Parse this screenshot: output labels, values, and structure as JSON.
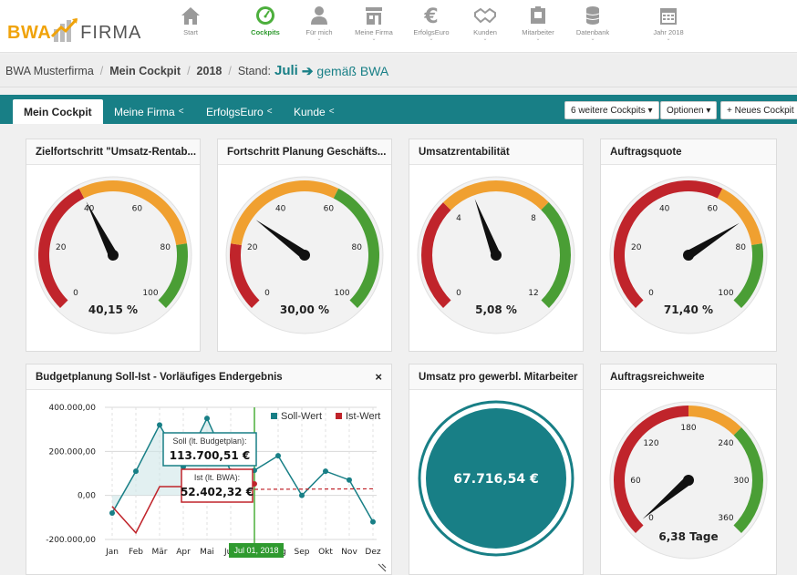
{
  "header": {
    "logo_left": "BWA",
    "logo_right": "FIRMA",
    "nav": [
      {
        "label": "Start",
        "icon": "home-icon"
      },
      {
        "label": "Cockpits",
        "icon": "gauge-icon",
        "active": true
      },
      {
        "label": "Für mich",
        "icon": "person-icon"
      },
      {
        "label": "Meine Firma",
        "icon": "building-icon"
      },
      {
        "label": "ErfolgsEuro",
        "icon": "euro-icon"
      },
      {
        "label": "Kunden",
        "icon": "handshake-icon"
      },
      {
        "label": "Mitarbeiter",
        "icon": "id-badge-icon"
      },
      {
        "label": "Datenbank",
        "icon": "database-icon"
      },
      {
        "label": "Jahr 2018",
        "icon": "calendar-icon"
      }
    ]
  },
  "breadcrumb": {
    "company": "BWA Musterfirma",
    "cockpit": "Mein Cockpit",
    "year": "2018",
    "stand_label": "Stand:",
    "month": "Juli",
    "source": "gemäß BWA"
  },
  "tabs": {
    "items": [
      "Mein Cockpit",
      "Meine Firma",
      "ErfolgsEuro",
      "Kunde"
    ],
    "more_cockpits": "6 weitere Cockpits ▾",
    "options": "Optionen ▾",
    "new_cockpit": "+ Neues Cockpit"
  },
  "gauges": [
    {
      "title": "Zielfortschritt \"Umsatz-Rentab...",
      "ticks": [
        "0",
        "20",
        "40",
        "60",
        "80",
        "100"
      ],
      "value_text": "40,15 %",
      "fraction": 0.4015,
      "bands": [
        "#c0242b",
        "#f0a030",
        "#4a9e35"
      ],
      "band_split": [
        0.4,
        0.8
      ]
    },
    {
      "title": "Fortschritt Planung Geschäfts...",
      "ticks": [
        "0",
        "20",
        "40",
        "60",
        "80",
        "100"
      ],
      "value_text": "30,00 %",
      "fraction": 0.3,
      "bands": [
        "#c0242b",
        "#f0a030",
        "#4a9e35"
      ],
      "band_split": [
        0.2,
        0.6
      ]
    },
    {
      "title": "Umsatzrentabilität",
      "ticks": [
        "0",
        "4",
        "8",
        "12"
      ],
      "value_text": "5,08 %",
      "fraction": 0.4233,
      "bands": [
        "#c0242b",
        "#f0a030",
        "#4a9e35"
      ],
      "band_split": [
        0.333,
        0.666
      ]
    },
    {
      "title": "Auftragsquote",
      "ticks": [
        "0",
        "20",
        "40",
        "60",
        "80",
        "100"
      ],
      "value_text": "71,40 %",
      "fraction": 0.714,
      "bands": [
        "#c0242b",
        "#f0a030",
        "#4a9e35"
      ],
      "band_split": [
        0.6,
        0.8
      ]
    }
  ],
  "budget": {
    "title": "Budgetplanung Soll-Ist - Vorläufiges Endergebnis",
    "close": "×",
    "legend_soll": "Soll-Wert",
    "legend_ist": "Ist-Wert",
    "tooltip_soll_label": "Soll (lt. Budgetplan):",
    "tooltip_soll_value": "113.700,51 €",
    "tooltip_ist_label": "Ist (lt. BWA):",
    "tooltip_ist_value": "52.402,32 €",
    "cursor_label": "Jul 01, 2018"
  },
  "umsatz": {
    "title": "Umsatz pro gewerbl. Mitarbeiter",
    "value": "67.716,54 €"
  },
  "reichweite": {
    "title": "Auftragsreichweite",
    "ticks": [
      "0",
      "60",
      "120",
      "180",
      "240",
      "300",
      "360"
    ],
    "value_text": "6,38 Tage",
    "fraction": 0.0177
  },
  "chart_data": {
    "type": "line",
    "categories": [
      "Jan",
      "Feb",
      "Mär",
      "Apr",
      "Mai",
      "Jun",
      "Jul",
      "Aug",
      "Sep",
      "Okt",
      "Nov",
      "Dez"
    ],
    "ylim": [
      -200000,
      400000
    ],
    "yticks": [
      "400.000,00",
      "200.000,00",
      "0,00",
      "-200.000,00"
    ],
    "ytick_values": [
      400000,
      200000,
      0,
      -200000
    ],
    "series": [
      {
        "name": "Soll-Wert",
        "color": "#187f86",
        "values": [
          -80000,
          110000,
          320000,
          130000,
          350000,
          110000,
          113700,
          180000,
          0,
          110000,
          70000,
          -120000
        ]
      },
      {
        "name": "Ist-Wert",
        "color": "#c0242b",
        "values": [
          -50000,
          -170000,
          40000,
          40000,
          40000,
          40000,
          52402,
          null,
          null,
          null,
          null,
          null
        ]
      }
    ],
    "forecast_value": 30000
  }
}
